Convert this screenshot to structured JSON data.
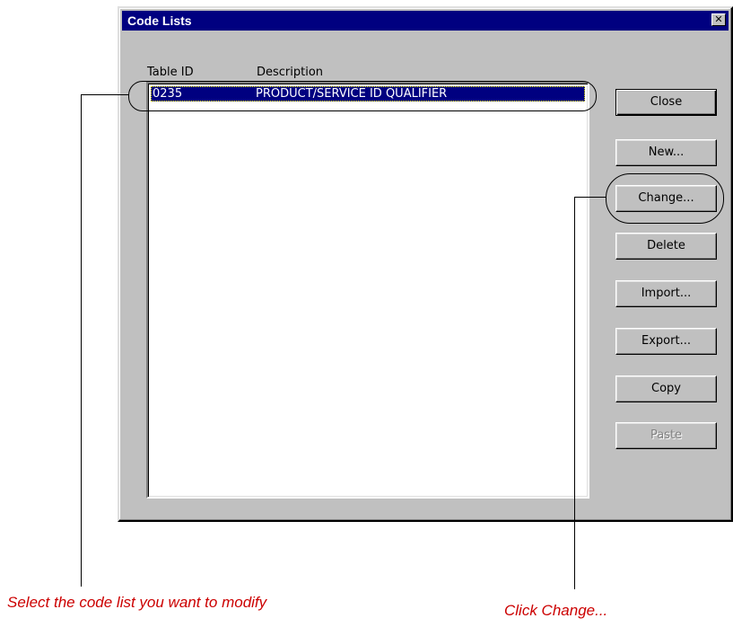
{
  "dialog": {
    "title": "Code Lists",
    "close_glyph": "✕",
    "columns": {
      "table_id": "Table ID",
      "description": "Description"
    },
    "rows": [
      {
        "table_id": "0235",
        "description": "PRODUCT/SERVICE ID QUALIFIER",
        "selected": true
      }
    ],
    "buttons": {
      "close": "Close",
      "new": "New...",
      "change": "Change...",
      "delete": "Delete",
      "import": "Import...",
      "export": "Export...",
      "copy": "Copy",
      "paste": "Paste"
    }
  },
  "annotations": {
    "select_caption": "Select the code list you want to modify",
    "change_caption": "Click Change..."
  },
  "colors": {
    "titlebar": "#000080",
    "dialog_face": "#c0c0c0",
    "selection": "#000080",
    "caption_text": "#cc0000"
  }
}
